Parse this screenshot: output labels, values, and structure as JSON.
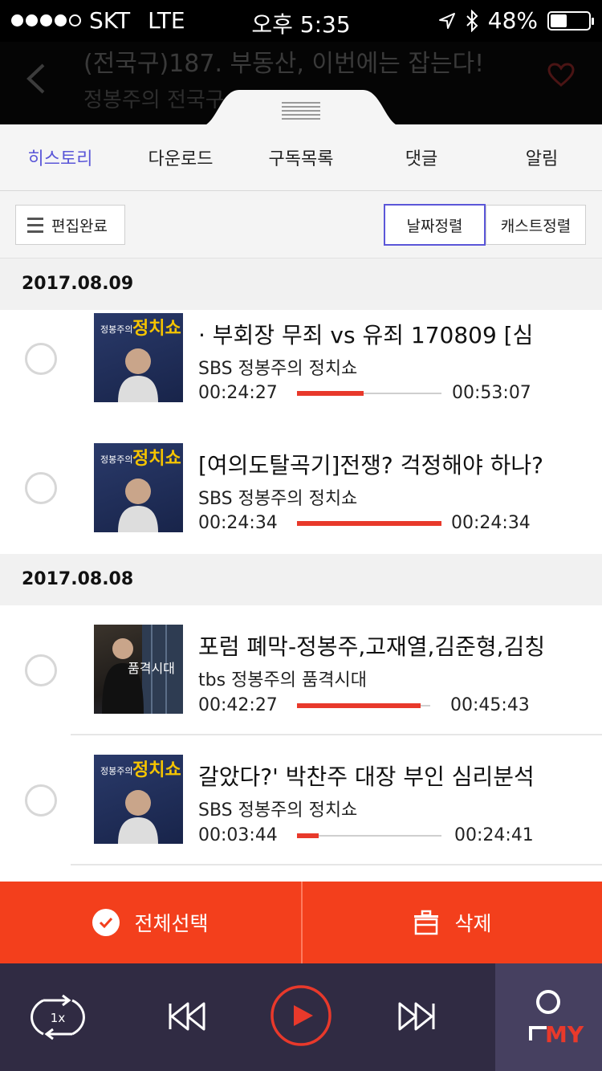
{
  "status_bar": {
    "carrier": "SKT",
    "network": "LTE",
    "time": "오후 5:35",
    "battery": "48%",
    "battery_level": 0.48
  },
  "header": {
    "title": "(전국구)187. 부동산, 이번에는 잡는다!",
    "subtitle": "정봉주의 전국구"
  },
  "tabs": [
    {
      "label": "히스토리",
      "active": true
    },
    {
      "label": "다운로드"
    },
    {
      "label": "구독목록"
    },
    {
      "label": "댓글"
    },
    {
      "label": "알림"
    }
  ],
  "toolbar": {
    "edit_label": "편집완료",
    "sort_date_label": "날짜정렬",
    "sort_cast_label": "캐스트정렬"
  },
  "groups": [
    {
      "date": "2017.08.09",
      "items": [
        {
          "title": "· 부회장 무죄 vs 유죄      170809 [심",
          "show": "SBS 정봉주의 정치쇼",
          "current": "00:24:27",
          "total": "00:53:07",
          "progress": 0.46,
          "thumb_text": "정치쇼",
          "thumb_host": "정봉주의"
        },
        {
          "title": "[여의도탈곡기]전쟁? 걱정해야 하나?",
          "show": "SBS 정봉주의 정치쇼",
          "current": "00:24:34",
          "total": "00:24:34",
          "progress": 1.0,
          "thumb_text": "정치쇼",
          "thumb_host": "정봉주의"
        }
      ]
    },
    {
      "date": "2017.08.08",
      "items": [
        {
          "title": "포럼 폐막-정봉주,고재열,김준형,김칭",
          "show": "tbs 정봉주의 품격시대",
          "current": "00:42:27",
          "total": "00:45:43",
          "progress": 0.93,
          "thumb_text": "품격시대"
        },
        {
          "title": "갈았다?' 박찬주 대장 부인 심리분석",
          "show": "SBS 정봉주의 정치쇼",
          "current": "00:03:44",
          "total": "00:24:41",
          "progress": 0.15,
          "thumb_text": "정치쇼",
          "thumb_host": "정봉주의"
        }
      ]
    }
  ],
  "actions": {
    "select_all_label": "전체선택",
    "delete_label": "삭제"
  },
  "player": {
    "speed_label": "1x",
    "my_label": "MY"
  },
  "colors": {
    "accent": "#5b57d8",
    "action_bar": "#f33f1c",
    "progress": "#e8392b",
    "player_bg": "#302b43"
  }
}
